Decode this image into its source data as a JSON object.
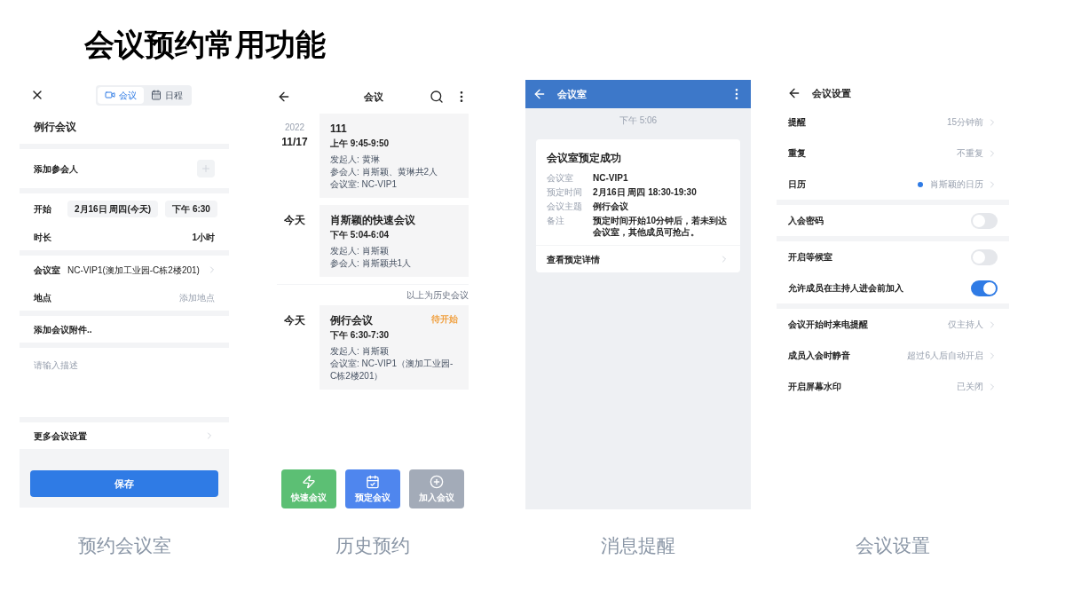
{
  "title": "会议预约常用功能",
  "booking": {
    "caption": "预约会议室",
    "tabs": [
      {
        "label": "会议",
        "selected": true
      },
      {
        "label": "日程",
        "selected": false
      }
    ],
    "subject": "例行会议",
    "add_participants": "添加参会人",
    "start": {
      "label": "开始",
      "date": "2月16日 周四(今天)",
      "time": "下午 6:30"
    },
    "duration": {
      "label": "时长",
      "value": "1小时"
    },
    "room": {
      "label": "会议室",
      "value": "NC-VIP1(澳加工业园-C栋2楼201)"
    },
    "location": {
      "label": "地点",
      "placeholder": "添加地点"
    },
    "attachment": "添加会议附件..",
    "description": {
      "placeholder": "请输入描述"
    },
    "more_settings": "更多会议设置",
    "save_button": "保存"
  },
  "history": {
    "caption": "历史预约",
    "title": "会议",
    "past_meetings": [
      {
        "year": "2022",
        "date": "11/17",
        "title": "111",
        "time": "上午 9:45-9:50",
        "details": [
          "发起人: 黄琳",
          "参会人: 肖斯颖、黄琳共2人",
          "会议室: NC-VIP1"
        ]
      },
      {
        "date": "今天",
        "title": "肖斯颖的快速会议",
        "time": "下午 5:04-6:04",
        "details": [
          "发起人: 肖斯颖",
          "参会人: 肖斯颖共1人"
        ]
      }
    ],
    "history_note": "以上为历史会议",
    "upcoming_meetings": [
      {
        "date": "今天",
        "title": "例行会议",
        "status": "待开始",
        "time": "下午 6:30-7:30",
        "details": [
          "发起人: 肖斯颖",
          "会议室: NC-VIP1（澳加工业园-C栋2楼201）"
        ]
      }
    ],
    "actions": [
      {
        "kind": "quick",
        "label": "快速会议"
      },
      {
        "kind": "schedule",
        "label": "预定会议"
      },
      {
        "kind": "join",
        "label": "加入会议"
      }
    ]
  },
  "notification": {
    "caption": "消息提醒",
    "title": "会议室",
    "time": "下午 5:06",
    "card": {
      "title": "会议室预定成功",
      "fields": [
        {
          "label": "会议室",
          "value": "NC-VIP1"
        },
        {
          "label": "预定时间",
          "value": "2月16日 周四 18:30-19:30"
        },
        {
          "label": "会议主题",
          "value": "例行会议"
        },
        {
          "label": "备注",
          "value": "预定时间开始10分钟后，若未到达会议室，其他成员可抢占。"
        }
      ],
      "link": "查看预定详情"
    }
  },
  "settings": {
    "caption": "会议设置",
    "title": "会议设置",
    "groups": [
      [
        {
          "kind": "link",
          "label": "提醒",
          "value": "15分钟前"
        },
        {
          "kind": "link",
          "label": "重复",
          "value": "不重复"
        },
        {
          "kind": "link",
          "label": "日历",
          "value": "肖斯颖的日历",
          "color": "#2f7be5"
        }
      ],
      [
        {
          "kind": "toggle",
          "label": "入会密码",
          "on": false
        }
      ],
      [
        {
          "kind": "toggle",
          "label": "开启等候室",
          "on": false
        },
        {
          "kind": "toggle",
          "label": "允许成员在主持人进会前加入",
          "on": true
        }
      ],
      [
        {
          "kind": "link",
          "label": "会议开始时来电提醒",
          "value": "仅主持人"
        },
        {
          "kind": "link",
          "label": "成员入会时静音",
          "value": "超过6人后自动开启"
        },
        {
          "kind": "link",
          "label": "开启屏幕水印",
          "value": "已关闭"
        }
      ]
    ]
  }
}
